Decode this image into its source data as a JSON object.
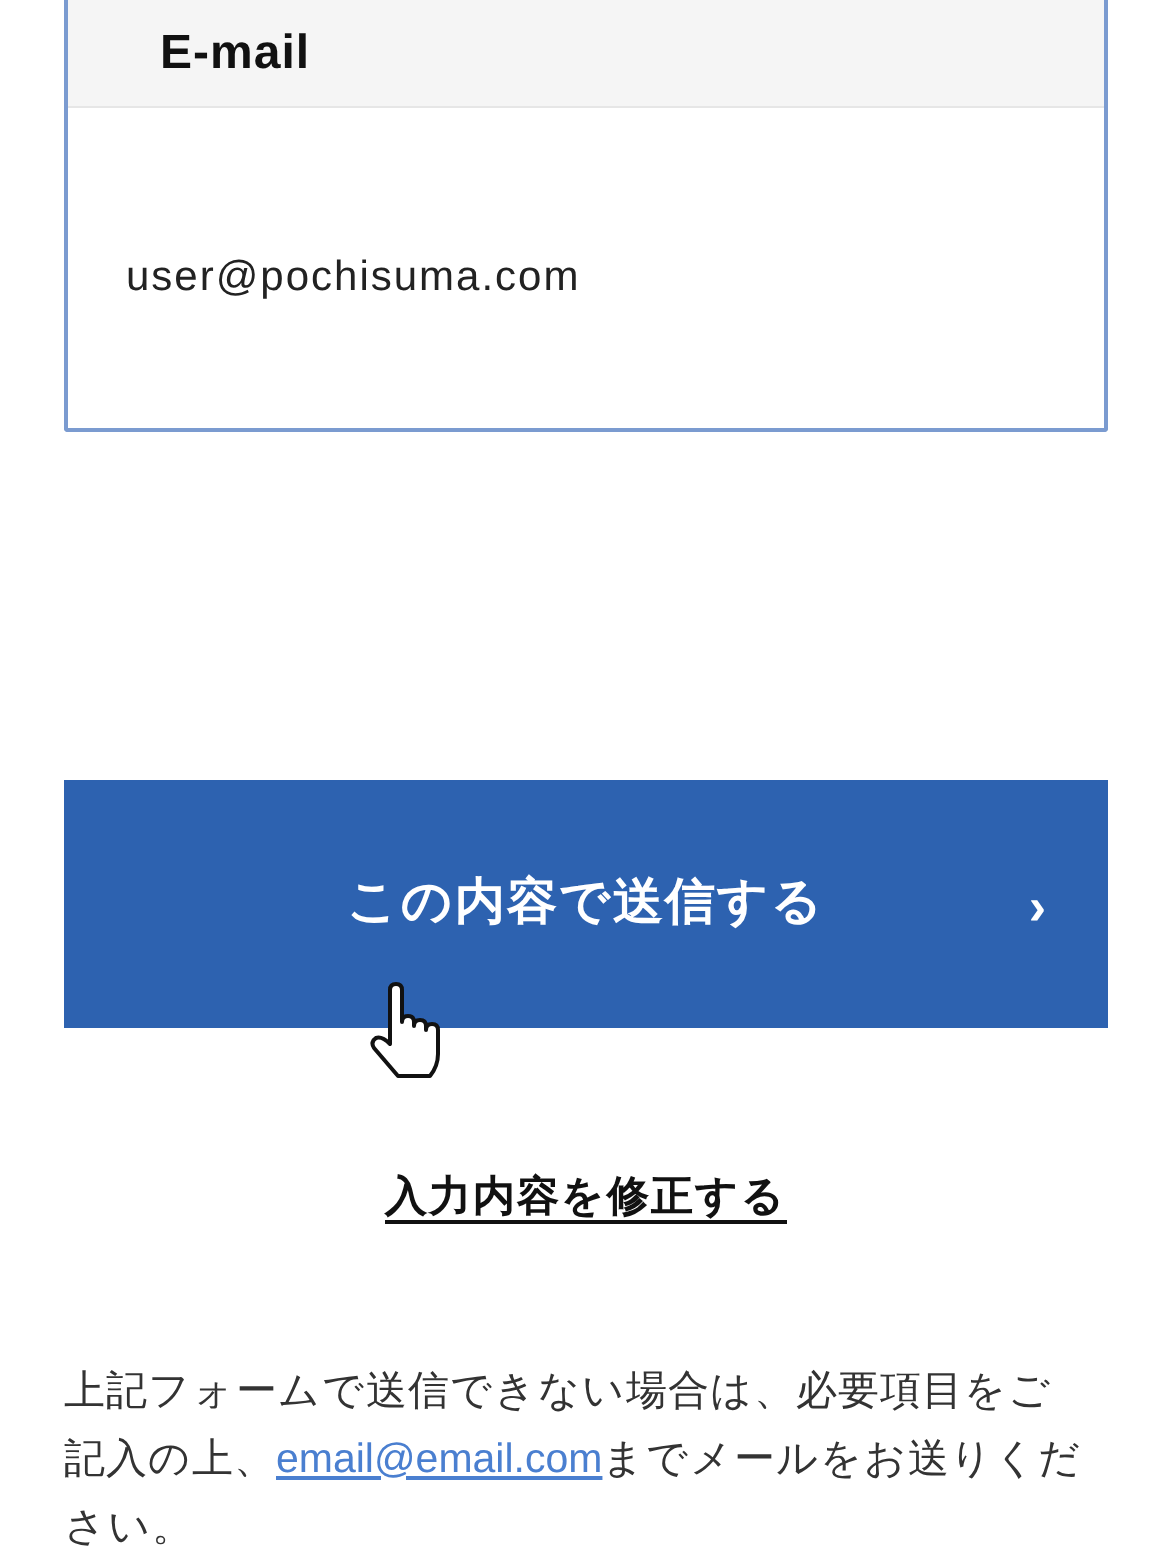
{
  "email_field": {
    "label": "E-mail",
    "value": "user@pochisuma.com"
  },
  "submit_button": {
    "label": "この内容で送信する",
    "arrow": "›"
  },
  "edit_link": {
    "label": "入力内容を修正する"
  },
  "notice": {
    "before": "上記フォームで送信できない場合は、必要項目をご記入の上、",
    "link": "email@email.com",
    "after": "までメールをお送りください。"
  }
}
